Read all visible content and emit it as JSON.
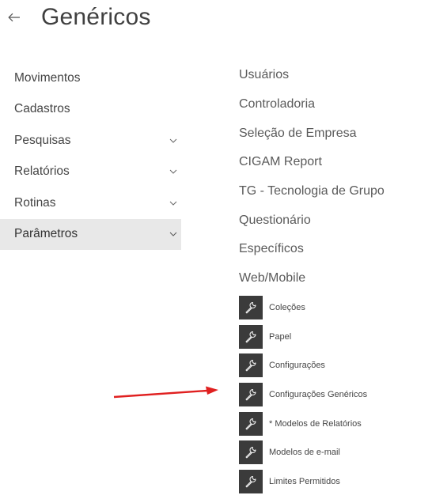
{
  "header": {
    "title": "Genéricos",
    "back_icon": "arrow-left-icon"
  },
  "sidebar": {
    "items": [
      {
        "label": "Movimentos",
        "has_chevron": false
      },
      {
        "label": "Cadastros",
        "has_chevron": false
      },
      {
        "label": "Pesquisas",
        "has_chevron": true
      },
      {
        "label": "Relatórios",
        "has_chevron": true
      },
      {
        "label": "Rotinas",
        "has_chevron": true
      },
      {
        "label": "Parâmetros",
        "has_chevron": true,
        "active": true
      }
    ]
  },
  "submenu": {
    "items": [
      {
        "label": "Usuários"
      },
      {
        "label": "Controladoria"
      },
      {
        "label": "Seleção de Empresa"
      },
      {
        "label": "CIGAM Report"
      },
      {
        "label": "TG - Tecnologia de Grupo"
      },
      {
        "label": "Questionário"
      },
      {
        "label": "Específicos"
      },
      {
        "label": "Web/Mobile"
      }
    ]
  },
  "tools": {
    "icon": "wrench-icon",
    "icon_bg": "#3b3b3b",
    "items": [
      {
        "label": "Coleções"
      },
      {
        "label": "Papel"
      },
      {
        "label": "Configurações"
      },
      {
        "label": "Configurações Genéricos"
      },
      {
        "label": "* Modelos de Relatórios"
      },
      {
        "label": "Modelos de e-mail"
      },
      {
        "label": "Limites Permitidos"
      }
    ]
  },
  "annotation": {
    "arrow_color": "#e02020",
    "points_to": "Configurações Genéricos"
  }
}
